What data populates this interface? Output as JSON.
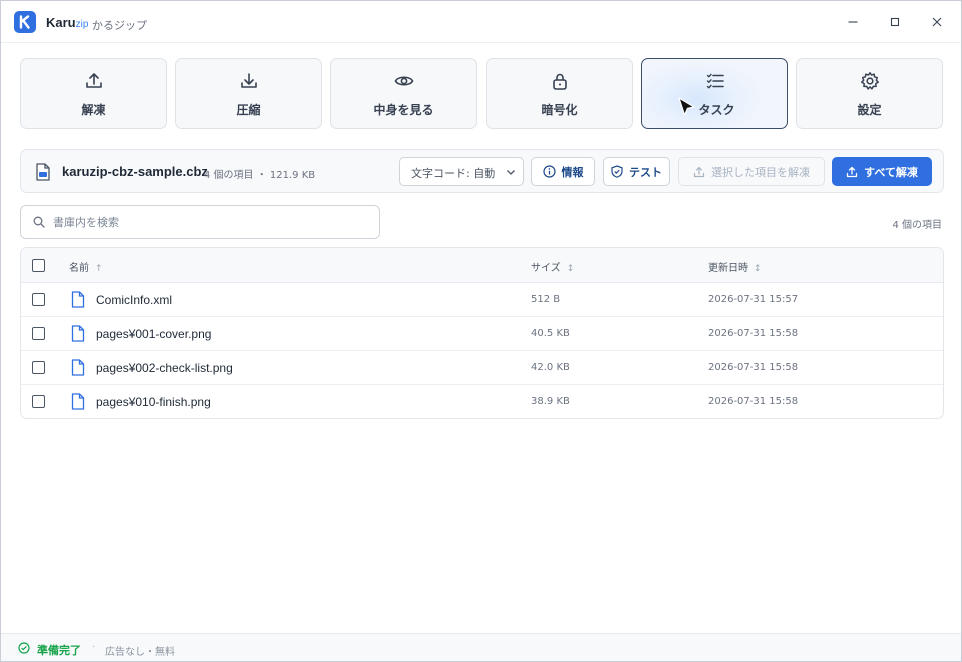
{
  "app": {
    "name": "Karu",
    "name_suffix": "zip",
    "subtitle": "かるジップ"
  },
  "toolbar": [
    {
      "label": "解凍",
      "icon": "upload-icon"
    },
    {
      "label": "圧縮",
      "icon": "download-icon"
    },
    {
      "label": "中身を見る",
      "icon": "eye-icon"
    },
    {
      "label": "暗号化",
      "icon": "lock-icon"
    },
    {
      "label": "タスク",
      "icon": "task-list-icon",
      "active": true
    },
    {
      "label": "設定",
      "icon": "gear-icon"
    }
  ],
  "file": {
    "name": "karuzip-cbz-sample.cbz",
    "meta": "4 個の項目 ・ 121.9 KB"
  },
  "encoding": {
    "selected": "文字コード: 自動"
  },
  "actions": {
    "info": "情報",
    "test": "テスト",
    "extract_selected": "選択した項目を解凍",
    "extract_all": "すべて解凍"
  },
  "search": {
    "placeholder": "書庫内を検索"
  },
  "item_count": "4 個の項目",
  "table": {
    "columns": {
      "name": "名前",
      "name_sort": "↑",
      "size": "サイズ",
      "size_sort": "↕",
      "modified": "更新日時",
      "modified_sort": "↕"
    },
    "rows": [
      {
        "name": "ComicInfo.xml",
        "size": "512 B",
        "modified": "2026-07-31 15:57"
      },
      {
        "name": "pages¥001-cover.png",
        "size": "40.5 KB",
        "modified": "2026-07-31 15:58"
      },
      {
        "name": "pages¥002-check-list.png",
        "size": "42.0 KB",
        "modified": "2026-07-31 15:58"
      },
      {
        "name": "pages¥010-finish.png",
        "size": "38.9 KB",
        "modified": "2026-07-31 15:58"
      }
    ]
  },
  "status": {
    "ready": "準備完了",
    "separator": "·",
    "note": "広告なし・無料"
  },
  "colors": {
    "accent": "#2f6fe0",
    "status_ok": "#16a34a"
  }
}
